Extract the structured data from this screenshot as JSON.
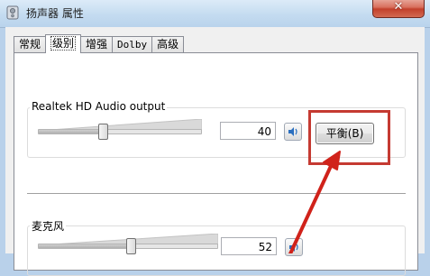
{
  "window": {
    "title": "扬声器 属性",
    "close_label": "✕"
  },
  "tabs": [
    {
      "label": "常规",
      "active": false
    },
    {
      "label": "级别",
      "active": true
    },
    {
      "label": "增强",
      "active": false
    },
    {
      "label": "Dolby",
      "active": false
    },
    {
      "label": "高级",
      "active": false
    }
  ],
  "levels": {
    "output": {
      "label": "Realtek HD Audio output",
      "value": "40",
      "level": 0.4,
      "speaker_icon": "speaker-icon",
      "balance_label": "平衡(B)"
    },
    "microphone": {
      "label": "麦克风",
      "value": "52",
      "level": 0.52,
      "speaker_icon": "speaker-icon"
    }
  },
  "annotation": {
    "highlight_color": "#c53a32",
    "arrow_color": "#d0221a"
  }
}
